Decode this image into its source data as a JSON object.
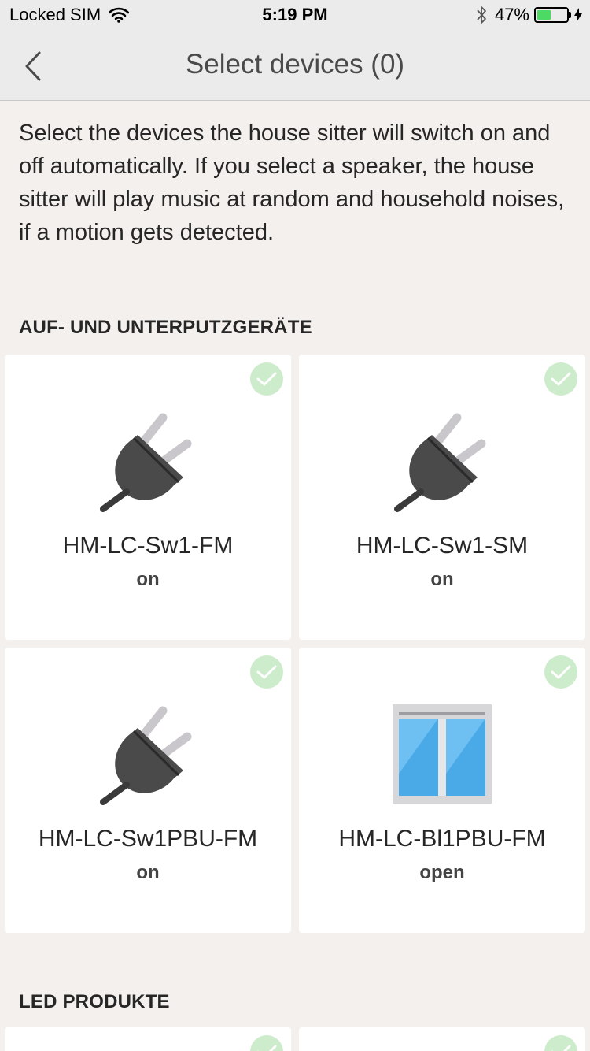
{
  "status_bar": {
    "carrier": "Locked SIM",
    "time": "5:19 PM",
    "battery_percent": "47%",
    "battery_level": 0.47
  },
  "nav": {
    "title": "Select devices (0)"
  },
  "description": "Select the devices the house sitter will switch on and off automatically. If you select a speaker, the house sitter will play music at random and household noises, if a motion gets detected.",
  "sections": [
    {
      "title": "AUF- UND UNTERPUTZGERÄTE",
      "devices": [
        {
          "name": "HM-LC-Sw1-FM",
          "state": "on",
          "icon": "plug-icon",
          "selected": true
        },
        {
          "name": "HM-LC-Sw1-SM",
          "state": "on",
          "icon": "plug-icon",
          "selected": true
        },
        {
          "name": "HM-LC-Sw1PBU-FM",
          "state": "on",
          "icon": "plug-icon",
          "selected": true
        },
        {
          "name": "HM-LC-Bl1PBU-FM",
          "state": "open",
          "icon": "window-icon",
          "selected": true
        }
      ]
    },
    {
      "title": "LED PRODUKTE",
      "devices": []
    }
  ],
  "colors": {
    "accent_check": "#cdeccb",
    "background": "#f4f0ed",
    "card": "#ffffff"
  }
}
